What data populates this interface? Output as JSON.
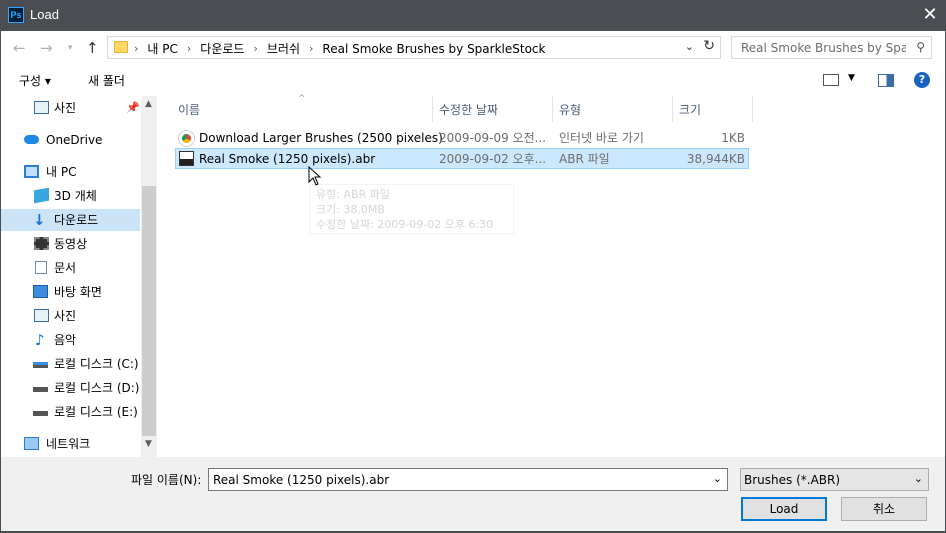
{
  "window": {
    "title": "Load",
    "app_icon": "Ps",
    "close_glyph": "✕"
  },
  "nav": {
    "breadcrumb": [
      "내 PC",
      "다운로드",
      "브러쉬",
      "Real Smoke Brushes by SparkleStock"
    ],
    "search_placeholder": "Real Smoke Brushes by Spar..."
  },
  "toolbar": {
    "organize": "구성 ▾",
    "new_folder": "새 폴더",
    "help": "?"
  },
  "sidebar": {
    "items": [
      {
        "label": "사진",
        "icon": "pictures-icon"
      },
      {
        "label": "OneDrive",
        "icon": "onedrive-icon"
      },
      {
        "label": "내 PC",
        "icon": "this-pc-icon"
      },
      {
        "label": "3D 개체",
        "icon": "3d-objects-icon"
      },
      {
        "label": "다운로드",
        "icon": "downloads-icon"
      },
      {
        "label": "동영상",
        "icon": "videos-icon"
      },
      {
        "label": "문서",
        "icon": "documents-icon"
      },
      {
        "label": "바탕 화면",
        "icon": "desktop-icon"
      },
      {
        "label": "사진",
        "icon": "pictures-icon"
      },
      {
        "label": "음악",
        "icon": "music-icon"
      },
      {
        "label": "로컬 디스크 (C:)",
        "icon": "system-drive-icon"
      },
      {
        "label": "로컬 디스크 (D:)",
        "icon": "drive-icon"
      },
      {
        "label": "로컬 디스크 (E:)",
        "icon": "drive-icon"
      },
      {
        "label": "네트워크",
        "icon": "network-icon"
      }
    ]
  },
  "columns": {
    "name": "이름",
    "modified": "수정한 날짜",
    "type": "유형",
    "size": "크기"
  },
  "files": [
    {
      "name": "Download Larger Brushes (2500 pixeles)",
      "modified": "2009-09-09 오전...",
      "type": "인터넷 바로 가기",
      "size": "1KB",
      "icon": "internet-shortcut-icon"
    },
    {
      "name": "Real Smoke (1250 pixels).abr",
      "modified": "2009-09-02 오후...",
      "type": "ABR 파일",
      "size": "38,944KB",
      "icon": "abr-file-icon"
    }
  ],
  "tooltip": {
    "line1": "유형: ABR 파일",
    "line2": "크기: 38.0MB",
    "line3": "수정한 날짜: 2009-09-02 오후 6:30"
  },
  "footer": {
    "filename_label": "파일 이름(N):",
    "filename_value": "Real Smoke (1250 pixels).abr",
    "filter_value": "Brushes (*.ABR)",
    "load_button": "Load",
    "cancel_button": "취소"
  },
  "colors": {
    "titlebar": "#4a4d52",
    "selection": "#cce8ff",
    "sidebar_selection": "#cce4f7",
    "accent": "#0078d7"
  }
}
